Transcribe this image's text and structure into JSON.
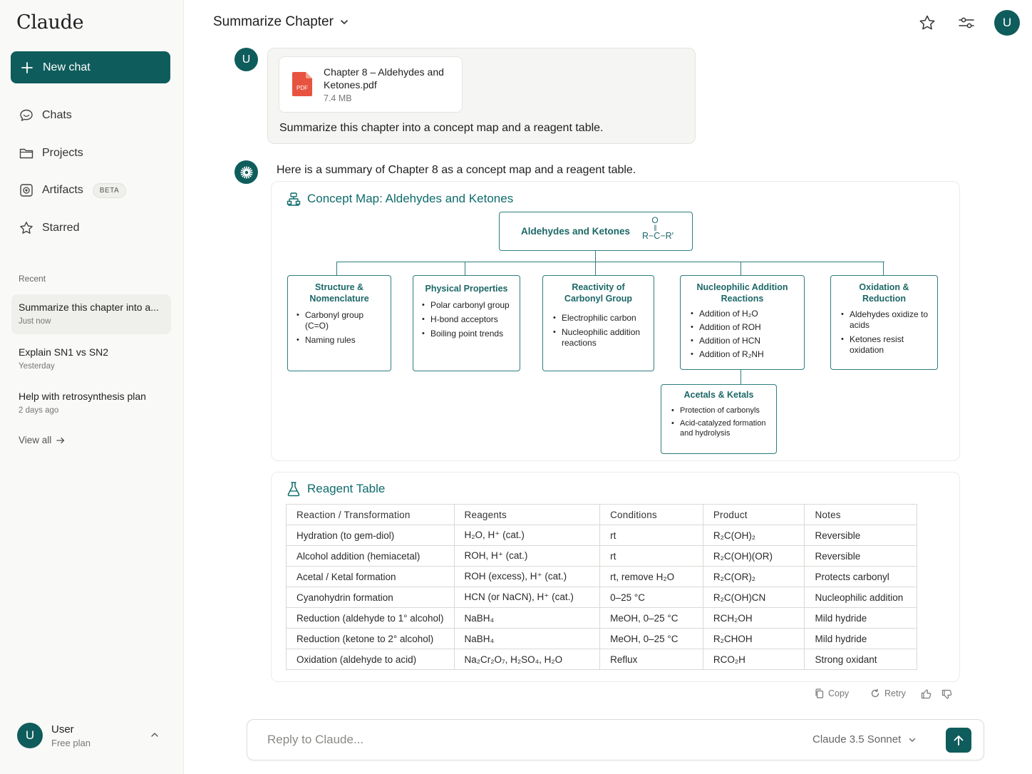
{
  "app": {
    "logo": "Claude"
  },
  "sidebar": {
    "new_chat": "New chat",
    "nav": [
      {
        "label": "Chats",
        "icon": "chat-bubble-icon"
      },
      {
        "label": "Projects",
        "icon": "folder-icon"
      },
      {
        "label": "Artifacts",
        "icon": "artifacts-icon",
        "badge": "BETA"
      },
      {
        "label": "Starred",
        "icon": "star-icon"
      }
    ],
    "recent_label": "Recent",
    "recent": [
      {
        "title": "Summarize this chapter into a...",
        "time": "Just now"
      },
      {
        "title": "Explain SN1 vs SN2",
        "time": "Yesterday"
      },
      {
        "title": "Help with retrosynthesis plan",
        "time": "2 days ago"
      }
    ],
    "view_all": "View all",
    "user": {
      "initial": "U",
      "name": "User",
      "plan": "Free plan"
    }
  },
  "header": {
    "title": "Summarize Chapter",
    "avatar_initial": "U"
  },
  "user_message": {
    "avatar": "U",
    "file": {
      "name": "Chapter 8 – Aldehydes and Ketones.pdf",
      "size": "7.4 MB",
      "type_label": "PDF"
    },
    "text": "Summarize this chapter into a concept map and a reagent table."
  },
  "assistant": {
    "intro": "Here is a summary of Chapter 8 as a concept map and a reagent table.",
    "concept_map": {
      "heading": "Concept Map: Aldehydes and Ketones",
      "root": {
        "title": "Aldehydes and Ketones",
        "formula_o": "O",
        "formula_bond": "||",
        "formula": "R−C−R′"
      },
      "nodes": [
        {
          "title": "Structure & Nomenclature",
          "items": [
            "Carbonyl group (C=O)",
            "Naming rules"
          ]
        },
        {
          "title": "Physical Properties",
          "items": [
            "Polar carbonyl group",
            "H-bond acceptors",
            "Boiling point trends"
          ]
        },
        {
          "title": "Reactivity of Carbonyl Group",
          "items": [
            "Electrophilic carbon",
            "Nucleophilic addition reactions"
          ]
        },
        {
          "title": "Nucleophilic Addition Reactions",
          "items": [
            "Addition of H₂O",
            "Addition of ROH",
            "Addition of HCN",
            "Addition of R₂NH"
          ]
        },
        {
          "title": "Oxidation & Reduction",
          "items": [
            "Aldehydes oxidize to acids",
            "Ketones resist oxidation"
          ]
        }
      ],
      "child": {
        "title": "Acetals & Ketals",
        "items": [
          "Protection of carbonyls",
          "Acid-catalyzed formation and hydrolysis"
        ]
      }
    },
    "reagent_table": {
      "heading": "Reagent Table",
      "columns": [
        "Reaction / Transformation",
        "Reagents",
        "Conditions",
        "Product",
        "Notes"
      ],
      "rows": [
        [
          "Hydration (to gem-diol)",
          "H₂O, H⁺ (cat.)",
          "rt",
          "R₂C(OH)₂",
          "Reversible"
        ],
        [
          "Alcohol addition (hemiacetal)",
          "ROH, H⁺ (cat.)",
          "rt",
          "R₂C(OH)(OR)",
          "Reversible"
        ],
        [
          "Acetal / Ketal formation",
          "ROH (excess), H⁺ (cat.)",
          "rt, remove H₂O",
          "R₂C(OR)₂",
          "Protects carbonyl"
        ],
        [
          "Cyanohydrin formation",
          "HCN (or NaCN), H⁺ (cat.)",
          "0–25 °C",
          "R₂C(OH)CN",
          "Nucleophilic addition"
        ],
        [
          "Reduction (aldehyde to 1° alcohol)",
          "NaBH₄",
          "MeOH, 0–25 °C",
          "RCH₂OH",
          "Mild hydride"
        ],
        [
          "Reduction (ketone to 2° alcohol)",
          "NaBH₄",
          "MeOH, 0–25 °C",
          "R₂CHOH",
          "Mild hydride"
        ],
        [
          "Oxidation (aldehyde to acid)",
          "Na₂Cr₂O₇, H₂SO₄, H₂O",
          "Reflux",
          "RCO₂H",
          "Strong oxidant"
        ]
      ]
    },
    "actions": {
      "copy": "Copy",
      "retry": "Retry"
    }
  },
  "composer": {
    "placeholder": "Reply to Claude...",
    "model": "Claude 3.5 Sonnet"
  },
  "colors": {
    "accent": "#0f5c5c",
    "heading": "#0f6b6b",
    "pdf_red": "#e8533f"
  }
}
